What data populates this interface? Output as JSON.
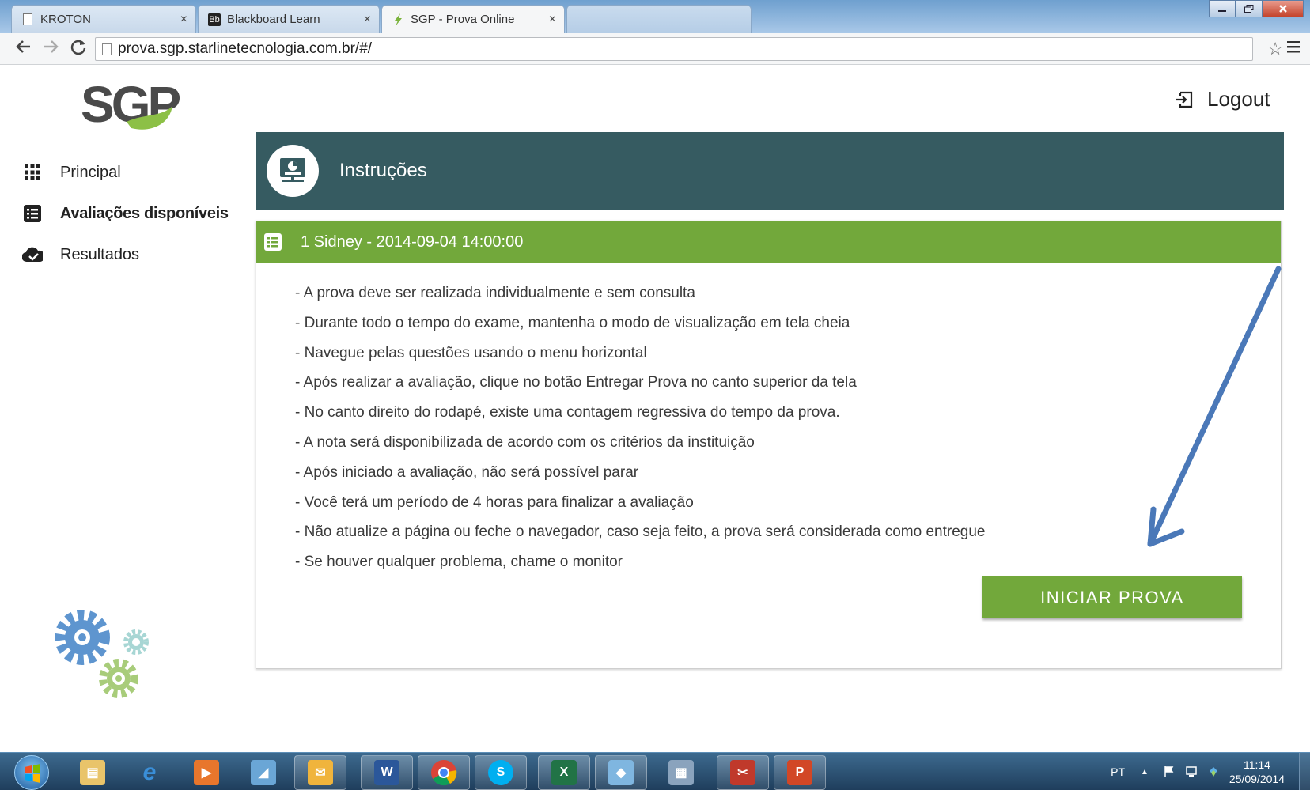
{
  "browser": {
    "tabs": [
      {
        "label": "KROTON",
        "icon": "page-icon",
        "close": "×"
      },
      {
        "label": "Blackboard Learn",
        "icon": "blackboard-icon",
        "icon_text": "Bb",
        "close": "×"
      },
      {
        "label": "SGP - Prova Online",
        "icon": "sgp-leaf-icon",
        "close": "×",
        "active": true
      }
    ],
    "url": "prova.sgp.starlinetecnologia.com.br/#/"
  },
  "header": {
    "logo_text": "SGP",
    "logout_label": "Logout"
  },
  "sidebar": {
    "items": [
      {
        "label": "Principal",
        "icon": "grid-icon"
      },
      {
        "label": "Avaliações disponíveis",
        "icon": "list-icon",
        "active": true
      },
      {
        "label": "Resultados",
        "icon": "cloud-check-icon"
      }
    ]
  },
  "instructions": {
    "title": "Instruções"
  },
  "exam": {
    "title": "1 Sidney - 2014-09-04 14:00:00",
    "rules": [
      "- A prova deve ser realizada individualmente e sem consulta",
      "- Durante todo o tempo do exame, mantenha o modo de visualização em tela cheia",
      "- Navegue pelas questões usando o menu horizontal",
      "- Após realizar a avaliação, clique no botão Entregar Prova no canto superior da tela",
      "- No canto direito do rodapé, existe uma contagem regressiva do tempo da prova.",
      "- A nota será disponibilizada de acordo com os critérios da instituição",
      "- Após iniciado a avaliação, não será possível parar",
      "- Você terá um período de 4 horas para finalizar a avaliação",
      "- Não atualize a página ou feche o navegador, caso seja feito, a prova será considerada como entregue",
      "- Se houver qualquer problema, chame o monitor"
    ],
    "start_button": "INICIAR PROVA"
  },
  "taskbar": {
    "apps": [
      "windows-explorer-icon",
      "internet-explorer-icon",
      "media-player-icon",
      "notepad-icon",
      "outlook-icon",
      "word-icon",
      "chrome-icon",
      "skype-icon",
      "excel-icon",
      "folder-icon",
      "calculator-icon",
      "snipping-tool-icon",
      "powerpoint-icon"
    ],
    "language": "PT",
    "time": "11:14",
    "date": "25/09/2014"
  },
  "colors": {
    "header_teal": "#365b61",
    "accent_green": "#72a83b",
    "arrow_blue": "#4a78b8"
  }
}
